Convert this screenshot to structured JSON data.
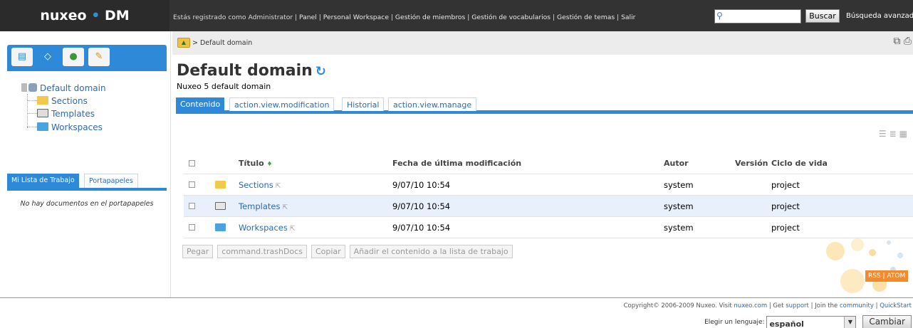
{
  "header": {
    "logo_main": "nuxeo",
    "logo_dot": " • ",
    "logo_dm": "DM",
    "registered": "Estás registrado como Administrator",
    "links": [
      "Panel",
      "Personal Workspace",
      "Gestión de miembros",
      "Gestión de vocabularios",
      "Gestión de temas",
      "Salir"
    ],
    "search_value": "",
    "search_button": "Buscar",
    "advanced_search": "Búsqueda avanzada"
  },
  "left_tabs": [
    "navigation-icon",
    "tag-icon",
    "globe-icon",
    "edit-icon"
  ],
  "tree": {
    "root": "Default domain",
    "children": [
      "Sections",
      "Templates",
      "Workspaces"
    ]
  },
  "worklist": {
    "tab_active": "Mi Lista de Trabajo",
    "tab_inactive": "Portapapeles",
    "empty_message": "No hay documentos en el portapapeles"
  },
  "breadcrumb": "> Default domain",
  "page": {
    "title": "Default domain",
    "description": "Nuxeo 5 default domain"
  },
  "tabs": [
    "Contenido",
    "action.view.modification",
    "Historial",
    "action.view.manage"
  ],
  "table": {
    "headers": {
      "title": "Título",
      "sort_glyph": "♦",
      "modified": "Fecha de última modificación",
      "author": "Autor",
      "version": "Versión",
      "lifecycle": "Ciclo de vida"
    },
    "rows": [
      {
        "title": "Sections",
        "modified": "9/07/10 10:54",
        "author": "system",
        "version": "",
        "lifecycle": "project",
        "icon_color": "#f2c94c"
      },
      {
        "title": "Templates",
        "modified": "9/07/10 10:54",
        "author": "system",
        "version": "",
        "lifecycle": "project",
        "icon_color": "#d9d9d9"
      },
      {
        "title": "Workspaces",
        "modified": "9/07/10 10:54",
        "author": "system",
        "version": "",
        "lifecycle": "project",
        "icon_color": "#4aa3df"
      }
    ]
  },
  "actions": [
    "Pegar",
    "command.trashDocs",
    "Copiar",
    "Añadir el contenido a la lista de trabajo"
  ],
  "feeds": "RSS | ATOM",
  "footer": {
    "copyright_prefix": "Copyright© 2006-2009 Nuxeo. Visit",
    "nuxeo_link": "nuxeo.com",
    "get": "| Get",
    "support_link": "support",
    "join": "| Join the",
    "community_link": "community",
    "sep": "|",
    "quickstart_link": "QuickStart",
    "language_label": "Elegir un lenguaje:",
    "language_value": "español",
    "change_button": "Cambiar"
  },
  "colors": {
    "accent": "#2e8ad8",
    "topbar": "#333333",
    "link": "#2c6bb3",
    "feeds": "#f28a2e"
  }
}
